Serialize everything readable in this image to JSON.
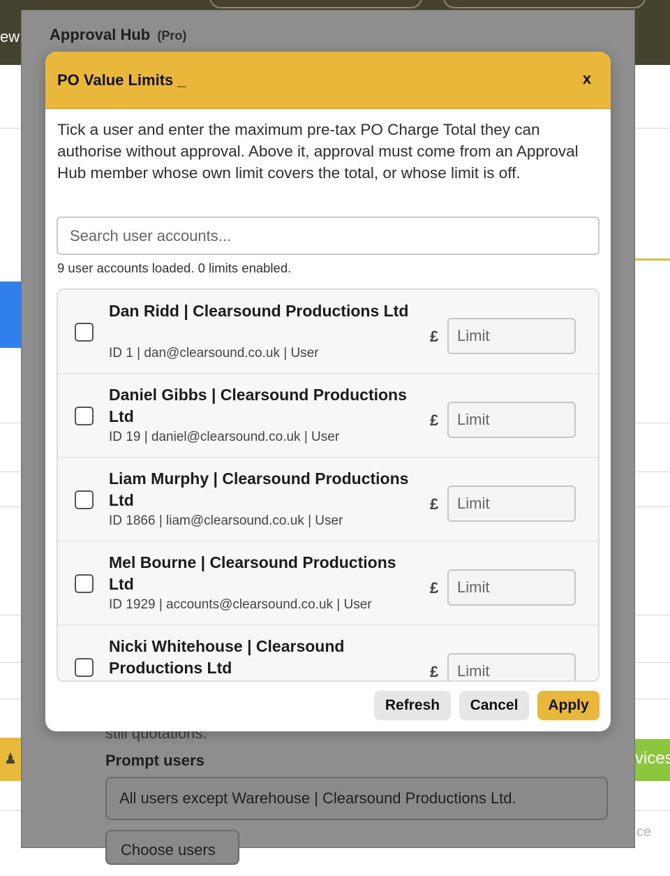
{
  "background": {
    "edge_text": "ew",
    "behind_text": "still quotations.",
    "right_button_fragment": "vices",
    "right_fragment": "ce"
  },
  "hub": {
    "title": "Approval Hub",
    "pro_badge": "(Pro)",
    "prompt_label": "Prompt users",
    "prompt_value": "All users except Warehouse | Clearsound Productions Ltd.",
    "choose_button": "Choose users"
  },
  "modal": {
    "title": "PO Value Limits _",
    "close_label": "x",
    "description": "Tick a user and enter the maximum pre-tax PO Charge Total they can authorise without approval. Above it, approval must come from an Approval Hub member whose own limit covers the total, or whose limit is off.",
    "search": {
      "placeholder": "Search user accounts...",
      "value": ""
    },
    "status": "9 user accounts loaded. 0 limits enabled.",
    "currency_symbol": "£",
    "limit_placeholder": "Limit",
    "users": [
      {
        "name": "Dan Ridd | Clearsound Productions Ltd",
        "meta": "ID 1 | dan@clearsound.co.uk | User",
        "checked": false
      },
      {
        "name": "Daniel Gibbs | Clearsound Productions Ltd",
        "meta": "ID 19 | daniel@clearsound.co.uk | User",
        "checked": false
      },
      {
        "name": "Liam Murphy | Clearsound Productions Ltd",
        "meta": "ID 1866 | liam@clearsound.co.uk | User",
        "checked": false
      },
      {
        "name": "Mel Bourne | Clearsound Productions Ltd",
        "meta": "ID 1929 | accounts@clearsound.co.uk | User",
        "checked": false
      },
      {
        "name": "Nicki Whitehouse | Clearsound Productions Ltd",
        "meta": "",
        "checked": false
      }
    ],
    "buttons": {
      "refresh": "Refresh",
      "cancel": "Cancel",
      "apply": "Apply"
    },
    "colors": {
      "header": "#e9b83a",
      "apply": "#e9b83a",
      "secondary": "#e6e6e6"
    }
  }
}
